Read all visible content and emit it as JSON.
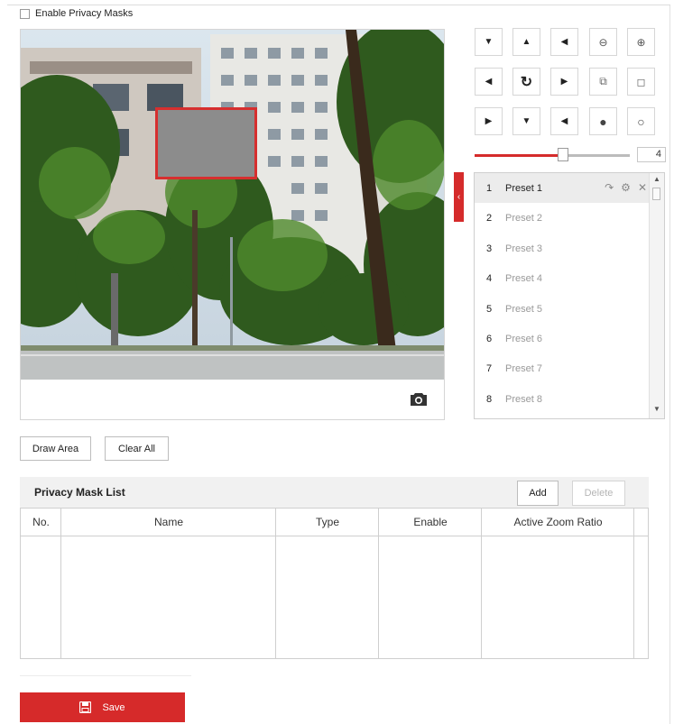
{
  "privacy": {
    "enable_label": "Enable Privacy Masks",
    "enabled": false
  },
  "video": {
    "snapshot_icon": "camera-icon"
  },
  "ptz": {
    "buttons": [
      "up-left-arrow-icon",
      "up-arrow-icon",
      "up-right-arrow-icon",
      "zoom-in-icon",
      "zoom-out-icon",
      "left-arrow-icon",
      "auto-pan-icon",
      "right-arrow-icon",
      "focus-near-icon",
      "focus-far-icon",
      "down-left-arrow-icon",
      "down-arrow-icon",
      "down-right-arrow-icon",
      "iris-open-icon",
      "iris-close-icon"
    ],
    "speed": 4,
    "speed_max": 7
  },
  "presets": [
    {
      "num": "1",
      "name": "Preset 1"
    },
    {
      "num": "2",
      "name": "Preset 2"
    },
    {
      "num": "3",
      "name": "Preset 3"
    },
    {
      "num": "4",
      "name": "Preset 4"
    },
    {
      "num": "5",
      "name": "Preset 5"
    },
    {
      "num": "6",
      "name": "Preset 6"
    },
    {
      "num": "7",
      "name": "Preset 7"
    },
    {
      "num": "8",
      "name": "Preset 8"
    }
  ],
  "actions": {
    "draw_area": "Draw Area",
    "clear_all": "Clear All"
  },
  "mask_list": {
    "title": "Privacy Mask List",
    "add_label": "Add",
    "delete_label": "Delete",
    "columns": [
      "No.",
      "Name",
      "Type",
      "Enable",
      "Active Zoom Ratio"
    ],
    "rows": []
  },
  "save_label": "Save",
  "colors": {
    "accent": "#d62a2a",
    "mask_fill": "#8c8c8c"
  }
}
